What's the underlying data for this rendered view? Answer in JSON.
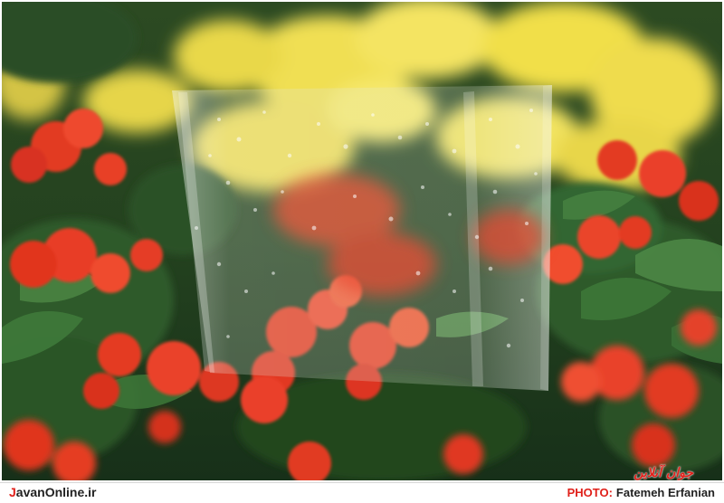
{
  "photo": {
    "subject": "",
    "palette": {
      "foliage_dark": "#1f3d22",
      "foliage_mid": "#3e6b32",
      "flower_red": "#e33b28",
      "flower_yellow": "#f2e35a",
      "plastic_tint": "#cfd9c8"
    },
    "watermark": "جوان آنلاین"
  },
  "footer": {
    "site_initial": "J",
    "site_rest": "avanOnline.ir",
    "photo_label": "PHOTO:",
    "photographer": "Fatemeh Erfanian"
  }
}
